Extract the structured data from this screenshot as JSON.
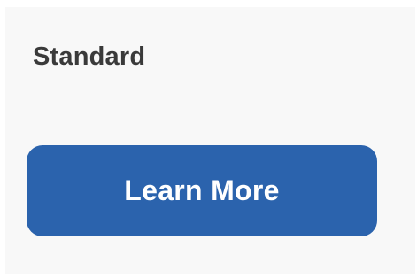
{
  "card": {
    "plan_name": "Standard",
    "button_label": "Learn More"
  },
  "colors": {
    "button_background": "#2b63ad",
    "button_text": "#ffffff",
    "card_background": "#f8f8f8",
    "title_text": "#3a3a3a"
  }
}
